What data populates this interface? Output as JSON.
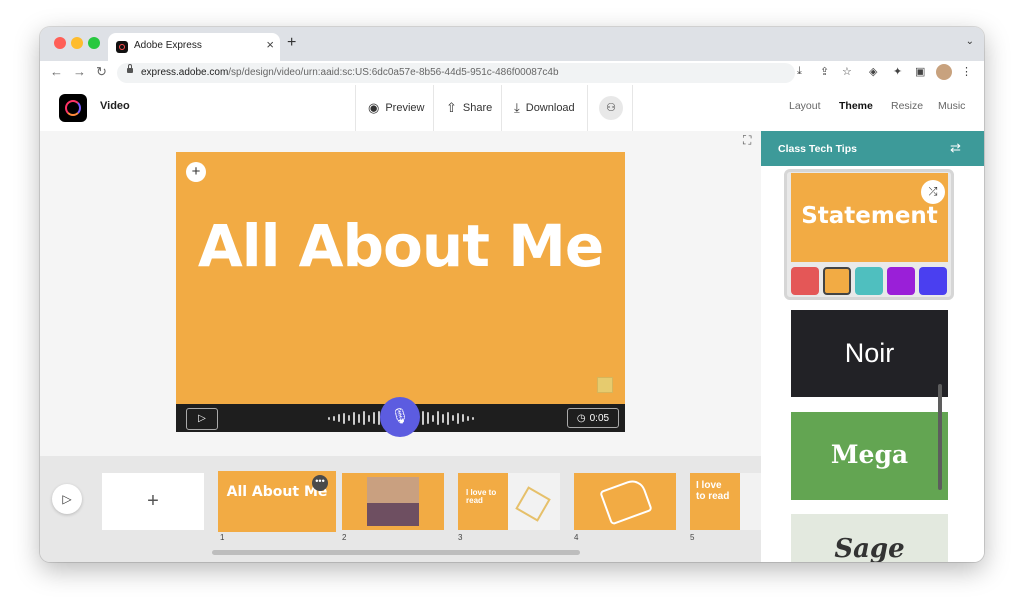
{
  "browser": {
    "tab_title": "Adobe Express",
    "tab_close": "×",
    "new_tab": "+",
    "url_host": "express.adobe.com",
    "url_path": "/sp/design/video/urn:aaid:sc:US:6dc0a57e-8b56-44d5-951c-486f00087c4b",
    "colors": {
      "close": "#ff5f57",
      "minimize": "#febc2e",
      "maximize": "#28c840"
    }
  },
  "header": {
    "doc_title": "Video",
    "preview_label": "Preview",
    "share_label": "Share",
    "download_label": "Download",
    "right_tabs": [
      "Layout",
      "Theme",
      "Resize",
      "Music"
    ],
    "active_tab": "Theme"
  },
  "canvas": {
    "slide_title": "All About Me",
    "slide_color": "#f2ab44",
    "duration": "0:05"
  },
  "timeline": {
    "scenes": [
      {
        "number": "1",
        "text": "All About Me",
        "selected": true
      },
      {
        "number": "2",
        "text": ""
      },
      {
        "number": "3",
        "text": "I love to read"
      },
      {
        "number": "4",
        "text": ""
      },
      {
        "number": "5",
        "text": "I love to read"
      }
    ]
  },
  "theme_panel": {
    "title": "Class Tech Tips",
    "themes": [
      {
        "name": "Statement",
        "bg": "#f2ab44",
        "selected": true
      },
      {
        "name": "Noir",
        "bg": "#222226"
      },
      {
        "name": "Mega",
        "bg": "#63a552"
      },
      {
        "name": "Sage",
        "bg": "#e3e9df"
      }
    ],
    "swatches": [
      "#e45757",
      "#f2ab44",
      "#4fbfbf",
      "#9a1fd8",
      "#4a3ff0"
    ]
  },
  "icons": [
    "back-icon",
    "forward-icon",
    "reload-icon",
    "lock-icon",
    "eye-icon",
    "share-icon",
    "download-icon",
    "invite-icon",
    "mic-icon",
    "play-icon",
    "clock-icon",
    "shuffle-icon",
    "swap-icon",
    "plus-icon",
    "more-icon"
  ]
}
